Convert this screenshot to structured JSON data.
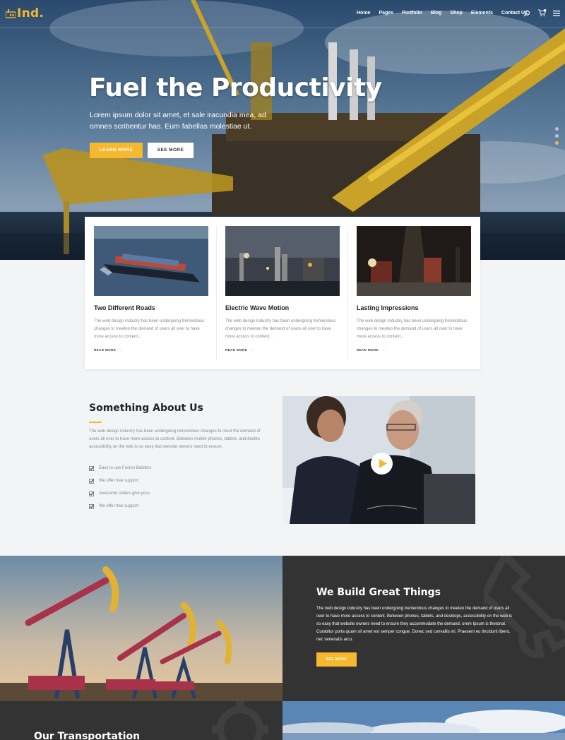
{
  "brand": {
    "name": "Ind."
  },
  "nav": {
    "items": [
      "Home",
      "Pages",
      "Portfolio",
      "Blog",
      "Shop",
      "Elements",
      "Contact Us"
    ],
    "search_icon": "search-icon",
    "cart_icon": "cart-icon",
    "menu_icon": "hamburger-icon"
  },
  "hero": {
    "title": "Fuel the Productivity",
    "subtitle": "Lorem ipsum dolor sit amet, et sale iracundia mea, ad omnes scribentur has. Eum fabellas molestiae ut.",
    "primary_button": "LEARN MORE",
    "secondary_button": "SEE MORE",
    "slide_count": 3,
    "active_slide": 3
  },
  "cards": [
    {
      "title": "Two Different Roads",
      "text": "The web design industry has been undergoing tremendous changes to meeteo the demand of users all over to have more access to content...",
      "link": "READ MORE"
    },
    {
      "title": "Electric Wave Motion",
      "text": "The web design industry has been undergoing tremendous changes to meeteo the demand of users all over to have more access to content...",
      "link": "READ MORE"
    },
    {
      "title": "Lasting Impressions",
      "text": "The web design industry has been undergoing tremendous changes to meeteo the demand of users all over to have more access to content...",
      "link": "READ MORE"
    }
  ],
  "about": {
    "title": "Something About Us",
    "text": "The web design industry has been undergoing tremendous changes to meet the demand of users all over to have more access to content. Between mobile phones, tablets, and deskto accessibility on the web is so easy that website owners need to ensure.",
    "checklist": [
      "Easy to use Fusion Builders",
      "We offer free support",
      "Awesome sliders give yous",
      "We offer free support"
    ]
  },
  "build": {
    "title": "We Build Great Things",
    "text": "The web design industry has been undergoing tremendous changes to meeteo the demand of users all over to have more access to content. Between  phones, tablets, and desktops, accessibility on the web is so easy that website owners need to ensure they accommodate the demand. orem Ipsum is thetonal. Curabitur porta quam sit amet est semper congue. Donec sed convallis mi. Praesent eu tincidunt libero, nec venenatis arcu.",
    "button": "SEE MORE"
  },
  "transport": {
    "title": "Our Transportation"
  },
  "colors": {
    "accent": "#f5b82e",
    "dark": "#333333",
    "light_bg": "#f3f4f6"
  }
}
